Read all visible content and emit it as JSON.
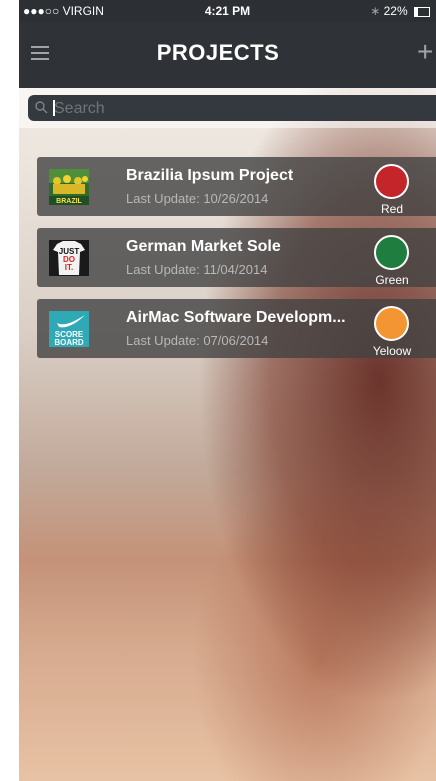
{
  "status_bar": {
    "carrier": "●●●○○ VIRGIN",
    "time": "4:21 PM",
    "battery": "22%"
  },
  "nav": {
    "title": "PROJECTS",
    "add_label": "+"
  },
  "search": {
    "placeholder": "Search"
  },
  "projects": [
    {
      "title": "Brazilia Ipsum Project",
      "updated": "Last Update: 10/26/2014",
      "status": "Red",
      "status_color": "#c4252a",
      "thumb_text": "BRAZIL"
    },
    {
      "title": "German Market Sole",
      "updated": "Last Update: 11/04/2014",
      "status": "Green",
      "status_color": "#1f7d3f",
      "thumb_text": "JUST DO IT."
    },
    {
      "title": "AirMac Software Developm...",
      "updated": "Last Update: 07/06/2014",
      "status": "Yeloow",
      "status_color": "#f29532",
      "thumb_text": "SCORE BOARD"
    }
  ]
}
